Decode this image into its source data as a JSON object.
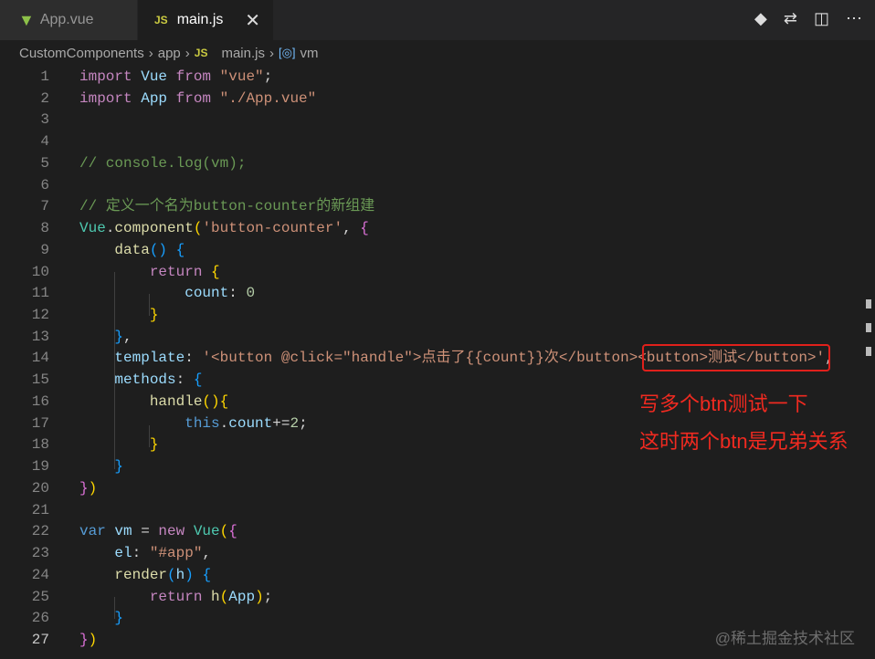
{
  "tabs": [
    {
      "label": "App.vue",
      "icon": "vue-icon"
    },
    {
      "label": "main.js",
      "icon": "js-icon",
      "active": true
    }
  ],
  "breadcrumb": [
    "CustomComponents",
    "app",
    "main.js",
    "vm"
  ],
  "icon_js": "JS",
  "lines": [
    [
      [
        "import ",
        "kw"
      ],
      [
        "Vue ",
        "id"
      ],
      [
        "from ",
        "kw"
      ],
      [
        "\"vue\"",
        "str"
      ],
      [
        ";",
        "pl"
      ]
    ],
    [
      [
        "import ",
        "kw"
      ],
      [
        "App ",
        "id"
      ],
      [
        "from ",
        "kw"
      ],
      [
        "\"./App.vue\"",
        "str"
      ]
    ],
    [],
    [],
    [
      [
        "// console.log(vm);",
        "cm"
      ]
    ],
    [],
    [
      [
        "// 定义一个名为button-counter的新组建",
        "cm"
      ]
    ],
    [
      [
        "Vue",
        "cl"
      ],
      [
        ".",
        "pl"
      ],
      [
        "component",
        "fn"
      ],
      [
        "(",
        "b1"
      ],
      [
        "'button-counter'",
        "str"
      ],
      [
        ", ",
        "pl"
      ],
      [
        "{",
        "b2"
      ]
    ],
    [
      [
        "    ",
        "pl"
      ],
      [
        "data",
        "fn"
      ],
      [
        "() ",
        "b3"
      ],
      [
        "{",
        "b3"
      ]
    ],
    [
      [
        "        ",
        "pl"
      ],
      [
        "return ",
        "kw"
      ],
      [
        "{",
        "b1"
      ]
    ],
    [
      [
        "            ",
        "pl"
      ],
      [
        "count",
        "id"
      ],
      [
        ": ",
        "pl"
      ],
      [
        "0",
        "num"
      ]
    ],
    [
      [
        "        ",
        "pl"
      ],
      [
        "}",
        "b1"
      ]
    ],
    [
      [
        "    ",
        "pl"
      ],
      [
        "}",
        "b3"
      ],
      [
        ",",
        "pl"
      ]
    ],
    [
      [
        "    ",
        "pl"
      ],
      [
        "template",
        "id"
      ],
      [
        ": ",
        "pl"
      ],
      [
        "'<button @click=\"handle\">点击了{{count}}次</button><button>测试</button>'",
        "str"
      ],
      [
        ",",
        "pl"
      ]
    ],
    [
      [
        "    ",
        "pl"
      ],
      [
        "methods",
        "id"
      ],
      [
        ": ",
        "pl"
      ],
      [
        "{",
        "b3"
      ]
    ],
    [
      [
        "        ",
        "pl"
      ],
      [
        "handle",
        "fn"
      ],
      [
        "()",
        "b1"
      ],
      [
        "{",
        "b1"
      ]
    ],
    [
      [
        "            ",
        "pl"
      ],
      [
        "this",
        "st"
      ],
      [
        ".",
        "pl"
      ],
      [
        "count",
        "id"
      ],
      [
        "+=",
        "pl"
      ],
      [
        "2",
        "num"
      ],
      [
        ";",
        "pl"
      ]
    ],
    [
      [
        "        ",
        "pl"
      ],
      [
        "}",
        "b1"
      ]
    ],
    [
      [
        "    ",
        "pl"
      ],
      [
        "}",
        "b3"
      ]
    ],
    [
      [
        "}",
        "b2"
      ],
      [
        ")",
        "b1"
      ]
    ],
    [],
    [
      [
        "var ",
        "st"
      ],
      [
        "vm ",
        "id"
      ],
      [
        "= ",
        "pl"
      ],
      [
        "new ",
        "kw"
      ],
      [
        "Vue",
        "cl"
      ],
      [
        "(",
        "b1"
      ],
      [
        "{",
        "b2"
      ]
    ],
    [
      [
        "    ",
        "pl"
      ],
      [
        "el",
        "id"
      ],
      [
        ": ",
        "pl"
      ],
      [
        "\"#app\"",
        "str"
      ],
      [
        ",",
        "pl"
      ]
    ],
    [
      [
        "    ",
        "pl"
      ],
      [
        "render",
        "fn"
      ],
      [
        "(",
        "b3"
      ],
      [
        "h",
        "id"
      ],
      [
        ") ",
        "b3"
      ],
      [
        "{",
        "b3"
      ]
    ],
    [
      [
        "        ",
        "pl"
      ],
      [
        "return ",
        "kw"
      ],
      [
        "h",
        "fn"
      ],
      [
        "(",
        "b1"
      ],
      [
        "App",
        "id"
      ],
      [
        ")",
        "b1"
      ],
      [
        ";",
        "pl"
      ]
    ],
    [
      [
        "    ",
        "pl"
      ],
      [
        "}",
        "b3"
      ]
    ],
    [
      [
        "}",
        "b2"
      ],
      [
        ")",
        "b1"
      ]
    ]
  ],
  "annotations": [
    "写多个btn测试一下",
    "这时两个btn是兄弟关系"
  ],
  "watermark": "@稀土掘金技术社区",
  "colors": {
    "accent": "#e0201b"
  }
}
